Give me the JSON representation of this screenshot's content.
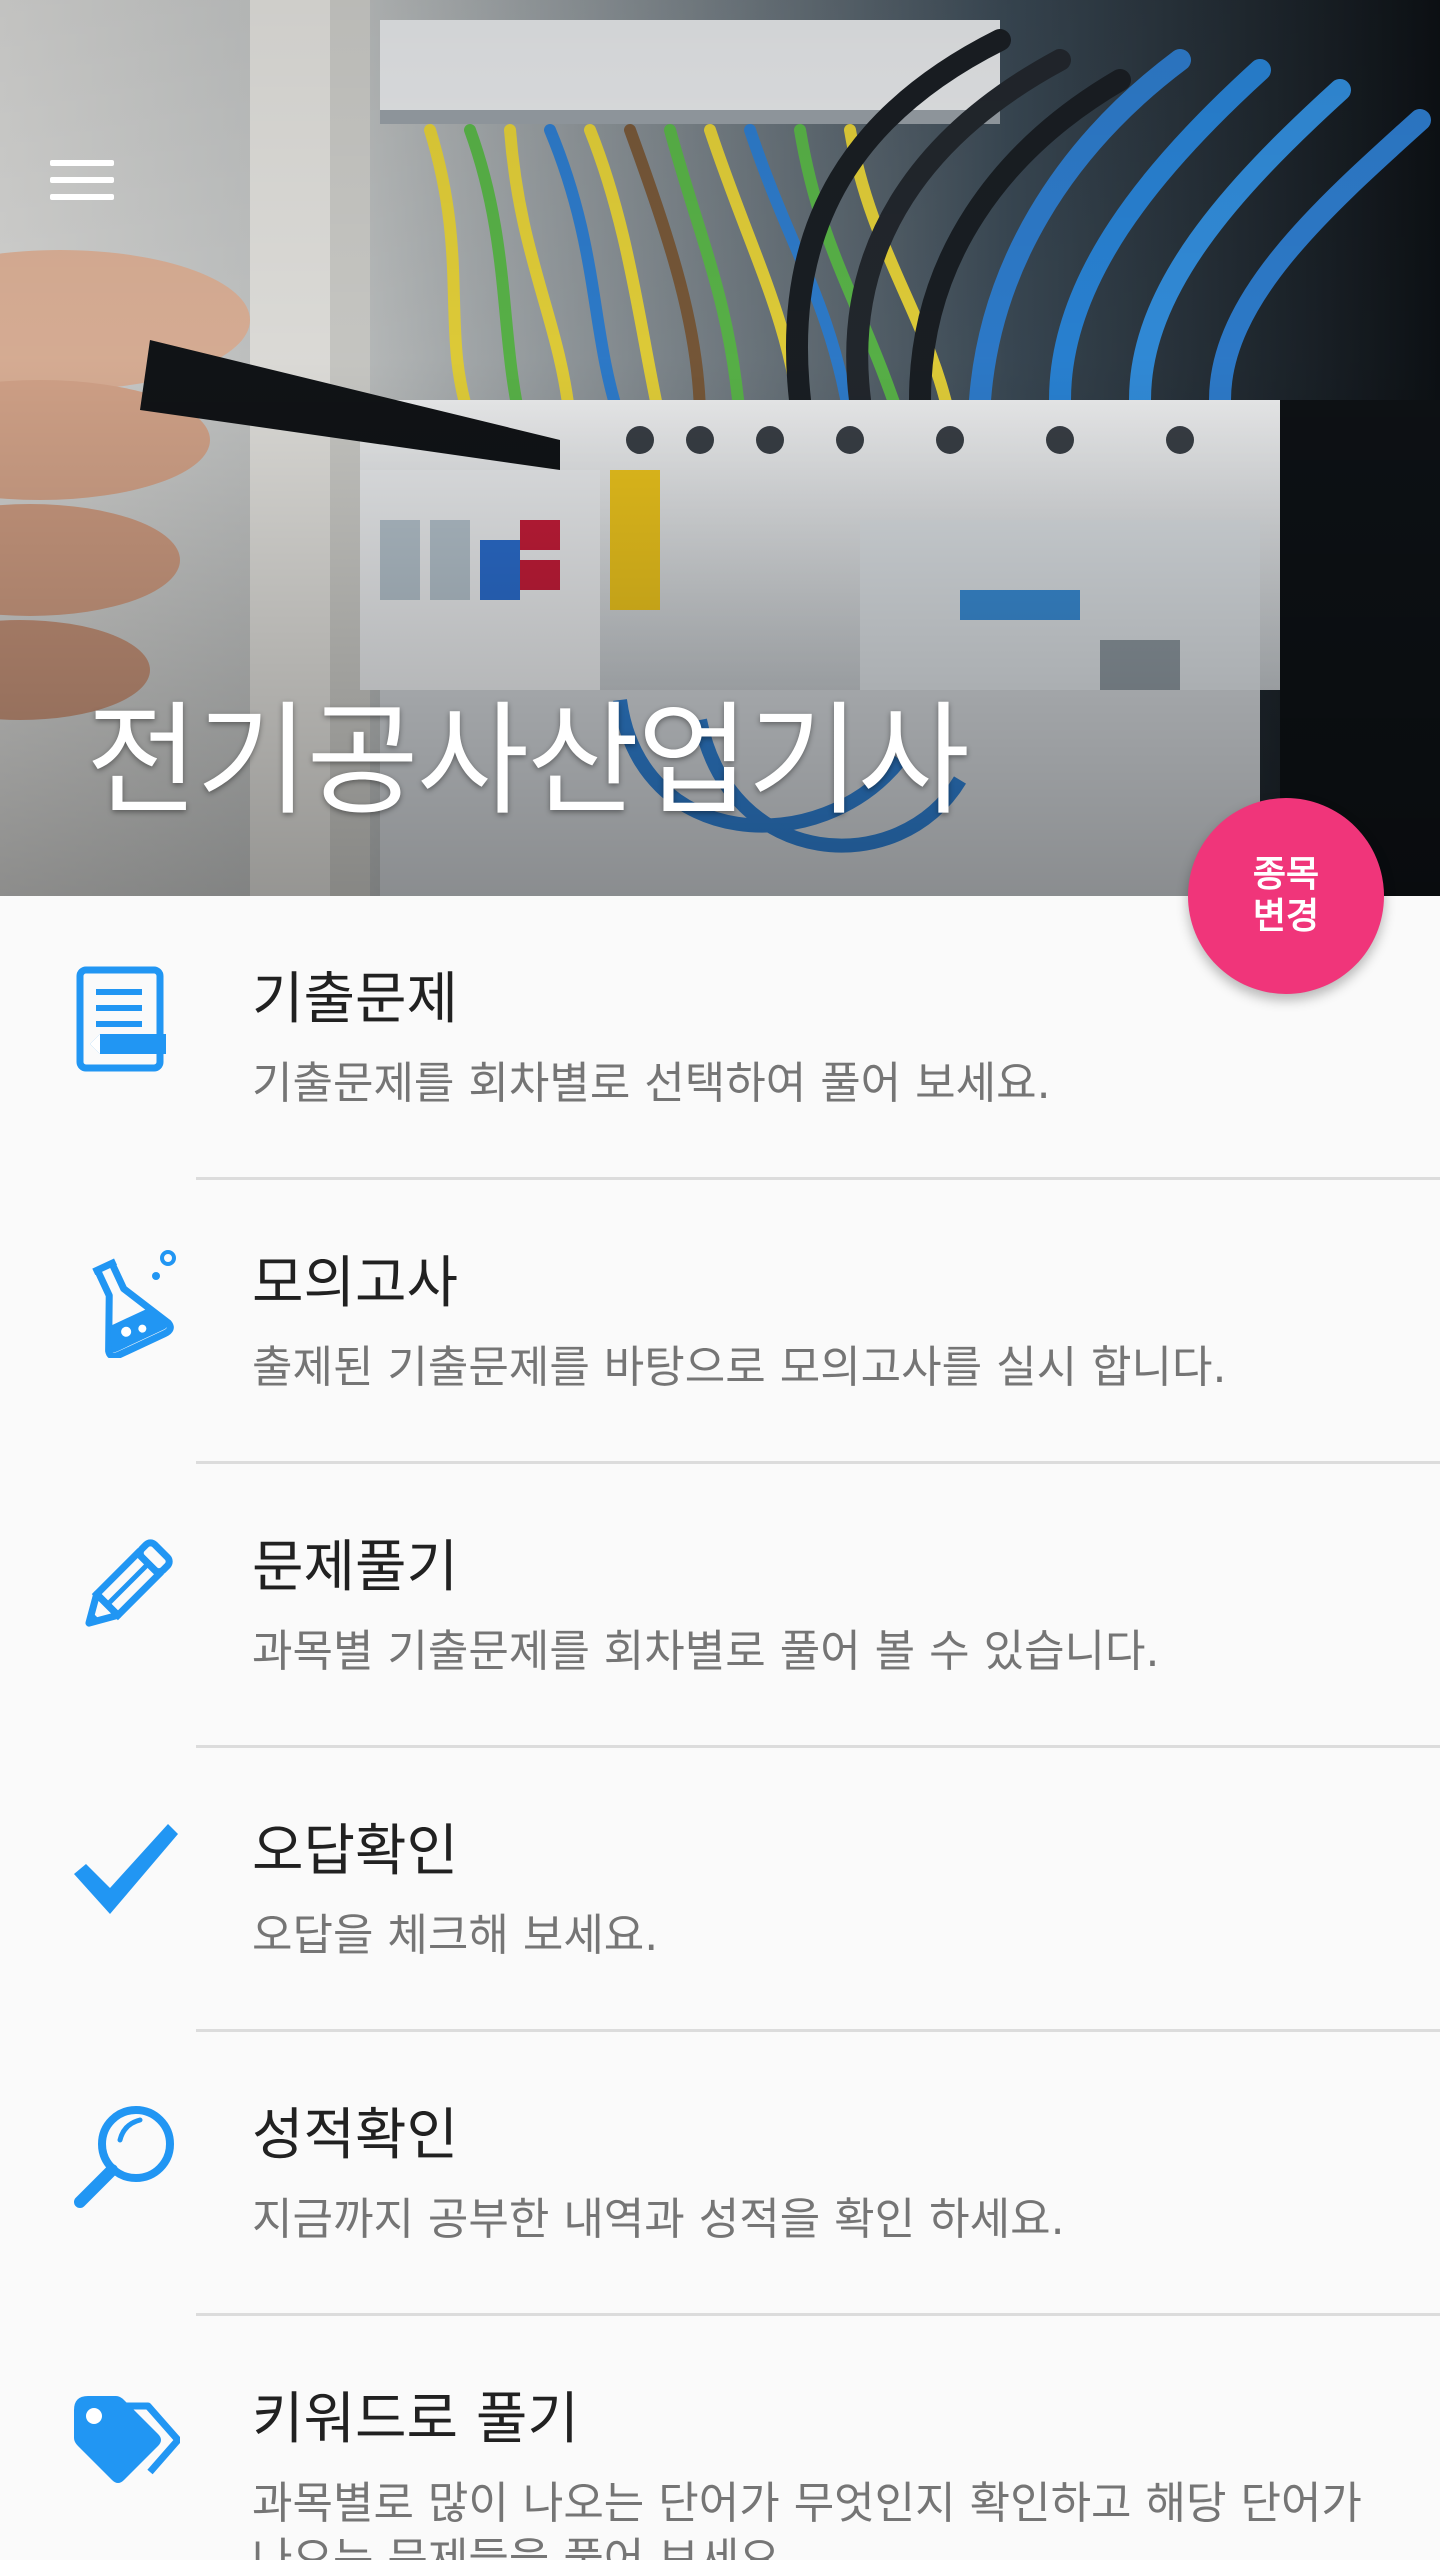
{
  "app": {
    "title": "전기공사산업기사"
  },
  "header": {
    "menu_icon": "hamburger-menu-icon",
    "background_image": "electrical-panel-photo"
  },
  "fab": {
    "label": "종목 변경",
    "color": "#f0357a"
  },
  "accent_color": "#2196f3",
  "menu": {
    "items": [
      {
        "title": "기출문제",
        "description": "기출문제를 회차별로 선택하여 풀어 보세요.",
        "icon": "exam-document-icon"
      },
      {
        "title": "모의고사",
        "description": "출제된 기출문제를 바탕으로 모의고사를 실시 합니다.",
        "icon": "flask-icon"
      },
      {
        "title": "문제풀기",
        "description": "과목별 기출문제를 회차별로 풀어 볼 수 있습니다.",
        "icon": "pencil-icon"
      },
      {
        "title": "오답확인",
        "description": "오답을 체크해 보세요.",
        "icon": "checkmark-icon"
      },
      {
        "title": "성적확인",
        "description": "지금까지 공부한 내역과 성적을 확인 하세요.",
        "icon": "magnifier-icon"
      },
      {
        "title": "키워드로 풀기",
        "description": "과목별로 많이 나오는 단어가 무엇인지 확인하고 해당 단어가 나오는 문제들을 풀어 보세요.",
        "icon": "tags-icon"
      }
    ]
  }
}
